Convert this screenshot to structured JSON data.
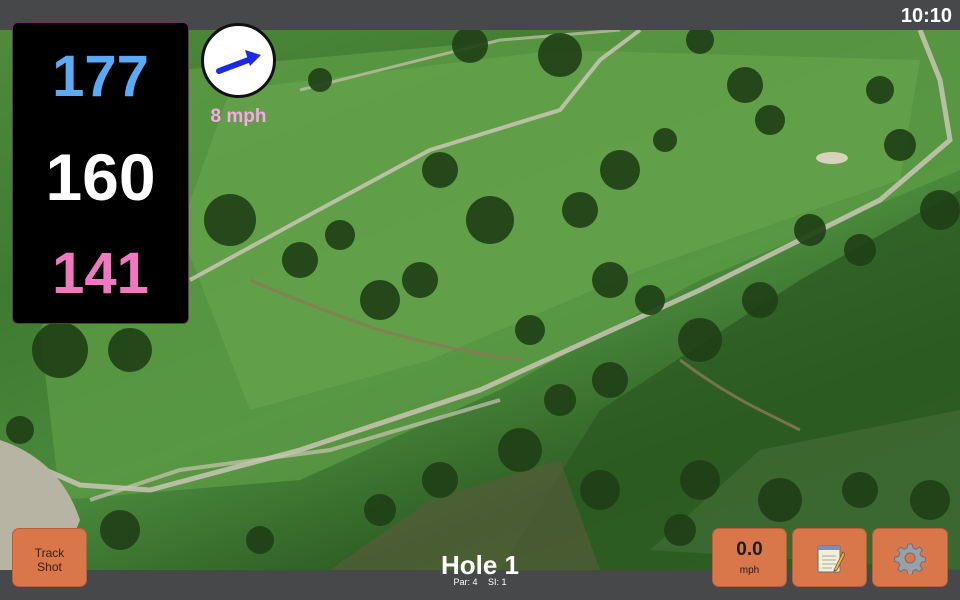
{
  "status_bar": {
    "time": "10:10"
  },
  "distances": {
    "back": "177",
    "center": "160",
    "front": "141"
  },
  "wind": {
    "speed_label": "8 mph",
    "icon": "wind-arrow-icon",
    "arrow_color": "#1a2ae6"
  },
  "colors": {
    "back": "#5aaaf5",
    "center": "#ffffff",
    "front": "#f078c0",
    "button": "#d9764a"
  },
  "hole": {
    "title": "Hole 1",
    "par": "Par: 4",
    "si": "SI: 1"
  },
  "buttons": {
    "track_shot_line1": "Track",
    "track_shot_line2": "Shot",
    "speed_value": "0.0",
    "speed_unit": "mph",
    "notes_icon": "notepad-icon",
    "settings_icon": "gear-icon"
  }
}
